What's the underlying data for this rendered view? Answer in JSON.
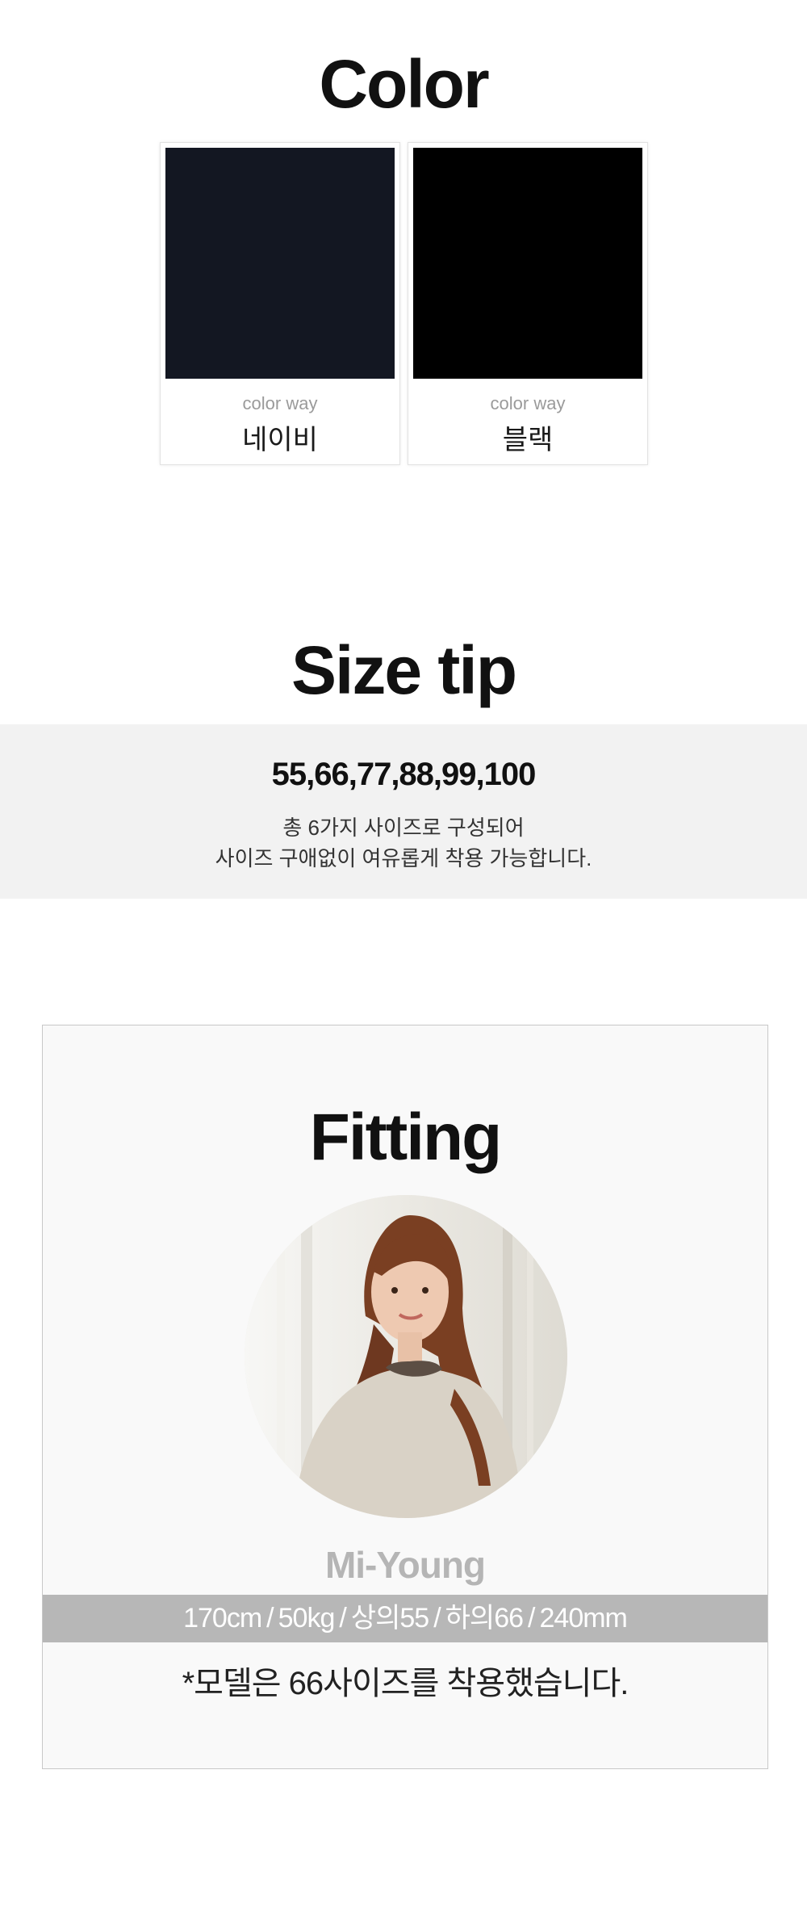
{
  "color_section": {
    "title": "Color",
    "swatches": [
      {
        "caption": "color way",
        "name": "네이비",
        "color": "#131722"
      },
      {
        "caption": "color way",
        "name": "블랙",
        "color": "#000000"
      }
    ]
  },
  "size_section": {
    "title": "Size tip",
    "sizes": "55,66,77,88,99,100",
    "desc_line1": "총 6가지 사이즈로 구성되어",
    "desc_line2": "사이즈 구애없이 여유롭게 착용 가능합니다."
  },
  "fitting_section": {
    "title": "Fitting",
    "model_name": "Mi-Young",
    "stats": [
      "170cm",
      "50kg",
      "상의55",
      "하의66",
      "240mm"
    ],
    "separator": "/",
    "note": "*모델은 66사이즈를 착용했습니다."
  }
}
